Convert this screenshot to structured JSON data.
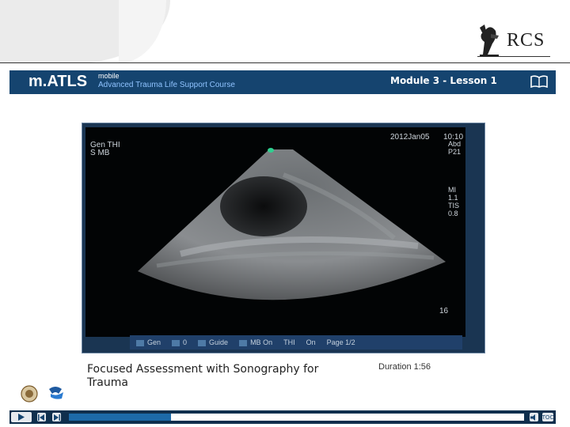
{
  "header": {
    "logo_text": "RCS"
  },
  "banner": {
    "title": "m.ATLS",
    "subtitle_top": "mobile",
    "subtitle_course": "Advanced Trauma Life Support Course",
    "module": "Module 3 - Lesson 1",
    "book_icon": "book-icon"
  },
  "ultrasound": {
    "top_left_line1": "Gen  THI",
    "top_left_line2": "S      MB",
    "date": "2012Jan05",
    "time": "10:10",
    "right_params": [
      "Abd",
      "P21",
      "MI",
      "1.1",
      "TIS",
      "0.8"
    ],
    "depth": "16",
    "toolbar": [
      "Gen",
      "0",
      "Guide",
      "MB On",
      "THI",
      "On",
      "Page 1/2"
    ]
  },
  "caption": {
    "title": "Focused Assessment with Sonography for Trauma",
    "duration": "Duration 1:56"
  },
  "player": {
    "progress_fraction": 0.225,
    "play_icon": "play-icon",
    "prev_icon": "previous-icon",
    "next_icon": "next-icon",
    "volume_icon": "volume-icon",
    "toc_label": "TOC"
  }
}
